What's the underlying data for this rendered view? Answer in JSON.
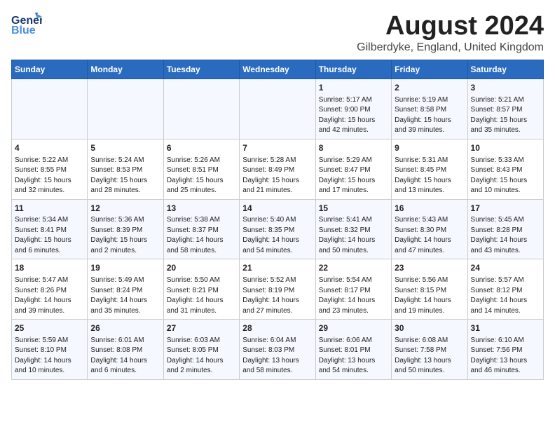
{
  "header": {
    "logo_line1": "General",
    "logo_line2": "Blue",
    "month_year": "August 2024",
    "location": "Gilberdyke, England, United Kingdom"
  },
  "days_of_week": [
    "Sunday",
    "Monday",
    "Tuesday",
    "Wednesday",
    "Thursday",
    "Friday",
    "Saturday"
  ],
  "weeks": [
    [
      {
        "day": "",
        "info": ""
      },
      {
        "day": "",
        "info": ""
      },
      {
        "day": "",
        "info": ""
      },
      {
        "day": "",
        "info": ""
      },
      {
        "day": "1",
        "info": "Sunrise: 5:17 AM\nSunset: 9:00 PM\nDaylight: 15 hours\nand 42 minutes."
      },
      {
        "day": "2",
        "info": "Sunrise: 5:19 AM\nSunset: 8:58 PM\nDaylight: 15 hours\nand 39 minutes."
      },
      {
        "day": "3",
        "info": "Sunrise: 5:21 AM\nSunset: 8:57 PM\nDaylight: 15 hours\nand 35 minutes."
      }
    ],
    [
      {
        "day": "4",
        "info": "Sunrise: 5:22 AM\nSunset: 8:55 PM\nDaylight: 15 hours\nand 32 minutes."
      },
      {
        "day": "5",
        "info": "Sunrise: 5:24 AM\nSunset: 8:53 PM\nDaylight: 15 hours\nand 28 minutes."
      },
      {
        "day": "6",
        "info": "Sunrise: 5:26 AM\nSunset: 8:51 PM\nDaylight: 15 hours\nand 25 minutes."
      },
      {
        "day": "7",
        "info": "Sunrise: 5:28 AM\nSunset: 8:49 PM\nDaylight: 15 hours\nand 21 minutes."
      },
      {
        "day": "8",
        "info": "Sunrise: 5:29 AM\nSunset: 8:47 PM\nDaylight: 15 hours\nand 17 minutes."
      },
      {
        "day": "9",
        "info": "Sunrise: 5:31 AM\nSunset: 8:45 PM\nDaylight: 15 hours\nand 13 minutes."
      },
      {
        "day": "10",
        "info": "Sunrise: 5:33 AM\nSunset: 8:43 PM\nDaylight: 15 hours\nand 10 minutes."
      }
    ],
    [
      {
        "day": "11",
        "info": "Sunrise: 5:34 AM\nSunset: 8:41 PM\nDaylight: 15 hours\nand 6 minutes."
      },
      {
        "day": "12",
        "info": "Sunrise: 5:36 AM\nSunset: 8:39 PM\nDaylight: 15 hours\nand 2 minutes."
      },
      {
        "day": "13",
        "info": "Sunrise: 5:38 AM\nSunset: 8:37 PM\nDaylight: 14 hours\nand 58 minutes."
      },
      {
        "day": "14",
        "info": "Sunrise: 5:40 AM\nSunset: 8:35 PM\nDaylight: 14 hours\nand 54 minutes."
      },
      {
        "day": "15",
        "info": "Sunrise: 5:41 AM\nSunset: 8:32 PM\nDaylight: 14 hours\nand 50 minutes."
      },
      {
        "day": "16",
        "info": "Sunrise: 5:43 AM\nSunset: 8:30 PM\nDaylight: 14 hours\nand 47 minutes."
      },
      {
        "day": "17",
        "info": "Sunrise: 5:45 AM\nSunset: 8:28 PM\nDaylight: 14 hours\nand 43 minutes."
      }
    ],
    [
      {
        "day": "18",
        "info": "Sunrise: 5:47 AM\nSunset: 8:26 PM\nDaylight: 14 hours\nand 39 minutes."
      },
      {
        "day": "19",
        "info": "Sunrise: 5:49 AM\nSunset: 8:24 PM\nDaylight: 14 hours\nand 35 minutes."
      },
      {
        "day": "20",
        "info": "Sunrise: 5:50 AM\nSunset: 8:21 PM\nDaylight: 14 hours\nand 31 minutes."
      },
      {
        "day": "21",
        "info": "Sunrise: 5:52 AM\nSunset: 8:19 PM\nDaylight: 14 hours\nand 27 minutes."
      },
      {
        "day": "22",
        "info": "Sunrise: 5:54 AM\nSunset: 8:17 PM\nDaylight: 14 hours\nand 23 minutes."
      },
      {
        "day": "23",
        "info": "Sunrise: 5:56 AM\nSunset: 8:15 PM\nDaylight: 14 hours\nand 19 minutes."
      },
      {
        "day": "24",
        "info": "Sunrise: 5:57 AM\nSunset: 8:12 PM\nDaylight: 14 hours\nand 14 minutes."
      }
    ],
    [
      {
        "day": "25",
        "info": "Sunrise: 5:59 AM\nSunset: 8:10 PM\nDaylight: 14 hours\nand 10 minutes."
      },
      {
        "day": "26",
        "info": "Sunrise: 6:01 AM\nSunset: 8:08 PM\nDaylight: 14 hours\nand 6 minutes."
      },
      {
        "day": "27",
        "info": "Sunrise: 6:03 AM\nSunset: 8:05 PM\nDaylight: 14 hours\nand 2 minutes."
      },
      {
        "day": "28",
        "info": "Sunrise: 6:04 AM\nSunset: 8:03 PM\nDaylight: 13 hours\nand 58 minutes."
      },
      {
        "day": "29",
        "info": "Sunrise: 6:06 AM\nSunset: 8:01 PM\nDaylight: 13 hours\nand 54 minutes."
      },
      {
        "day": "30",
        "info": "Sunrise: 6:08 AM\nSunset: 7:58 PM\nDaylight: 13 hours\nand 50 minutes."
      },
      {
        "day": "31",
        "info": "Sunrise: 6:10 AM\nSunset: 7:56 PM\nDaylight: 13 hours\nand 46 minutes."
      }
    ]
  ]
}
